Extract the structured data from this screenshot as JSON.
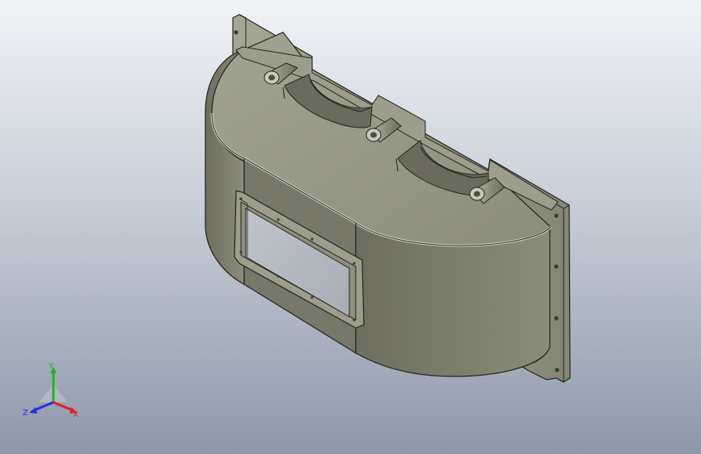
{
  "viewport": {
    "background_top": "#f1f3f7",
    "background_bottom": "#8e98aa"
  },
  "model": {
    "part_color": "#8a8b78",
    "part_shadow": "#5e5f52",
    "edge_color": "#23241e",
    "window_glass": "#b4b8bf"
  },
  "triad": {
    "x_label": "X",
    "y_label": "Y",
    "z_label": "Z",
    "x_color": "#e0202a",
    "y_color": "#22b022",
    "z_color": "#2233dd"
  }
}
